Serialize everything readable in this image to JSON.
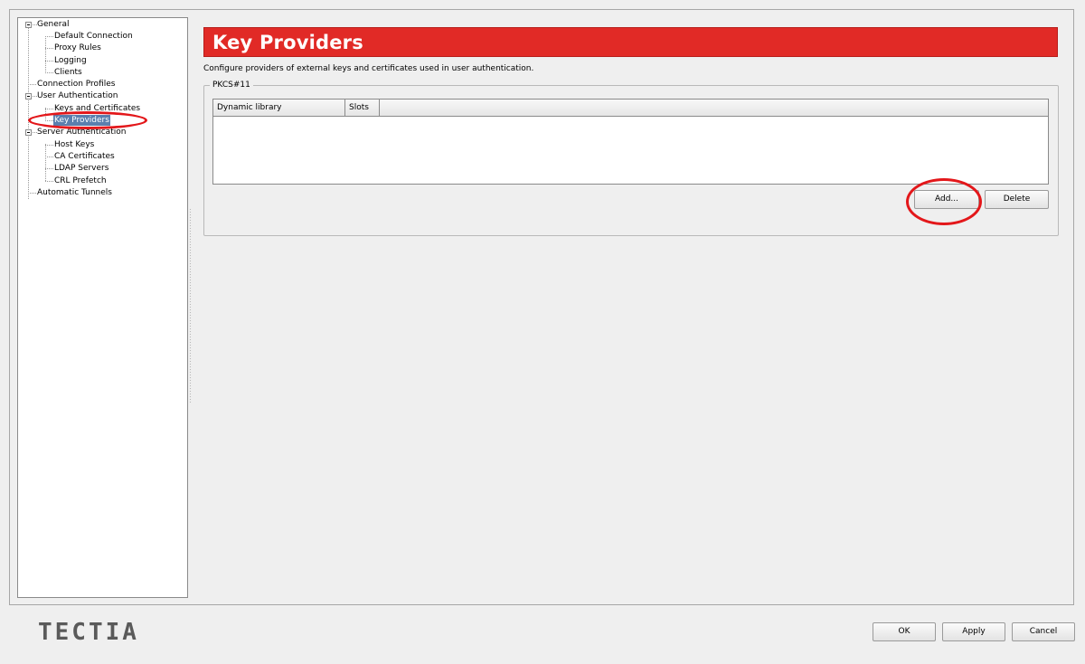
{
  "tree": {
    "items": [
      {
        "label": "General",
        "name": "tree-item-general"
      },
      {
        "label": "Default Connection",
        "name": "tree-item-default-connection"
      },
      {
        "label": "Proxy Rules",
        "name": "tree-item-proxy-rules"
      },
      {
        "label": "Logging",
        "name": "tree-item-logging"
      },
      {
        "label": "Clients",
        "name": "tree-item-clients"
      },
      {
        "label": "Connection Profiles",
        "name": "tree-item-connection-profiles"
      },
      {
        "label": "User Authentication",
        "name": "tree-item-user-authentication"
      },
      {
        "label": "Keys and Certificates",
        "name": "tree-item-keys-and-certificates"
      },
      {
        "label": "Key Providers",
        "name": "tree-item-key-providers"
      },
      {
        "label": "Server Authentication",
        "name": "tree-item-server-authentication"
      },
      {
        "label": "Host Keys",
        "name": "tree-item-host-keys"
      },
      {
        "label": "CA Certificates",
        "name": "tree-item-ca-certificates"
      },
      {
        "label": "LDAP Servers",
        "name": "tree-item-ldap-servers"
      },
      {
        "label": "CRL Prefetch",
        "name": "tree-item-crl-prefetch"
      },
      {
        "label": "Automatic Tunnels",
        "name": "tree-item-automatic-tunnels"
      }
    ],
    "selected": "Key Providers"
  },
  "page": {
    "title": "Key Providers",
    "description": "Configure providers of external keys and certificates used in user authentication."
  },
  "pkcs_group": {
    "legend": "PKCS#11",
    "columns": [
      "Dynamic library",
      "Slots"
    ],
    "rows": [],
    "add_label": "Add...",
    "delete_label": "Delete"
  },
  "footer": {
    "logo": "TECTIA",
    "ok_label": "OK",
    "apply_label": "Apply",
    "cancel_label": "Cancel"
  },
  "colors": {
    "header_bg": "#e12a26",
    "highlight_ring": "#e3171a",
    "selection": "#5a7fae"
  },
  "icons": [
    "collapse-icon"
  ]
}
